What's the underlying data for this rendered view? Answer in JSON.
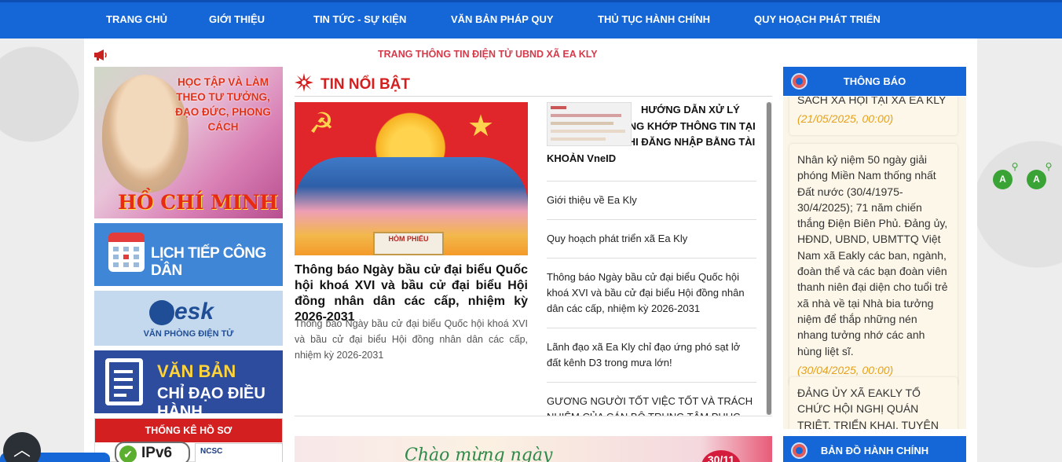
{
  "nav": {
    "items": [
      "TRANG CHỦ",
      "GIỚI THIỆU",
      "TIN TỨC - SỰ KIỆN",
      "VĂN BẢN PHÁP QUY",
      "THỦ TỤC HÀNH CHÍNH",
      "QUY HOẠCH PHÁT TRIỂN"
    ]
  },
  "marquee": {
    "text": "TRANG THÔNG TIN ĐIỆN TỬ UBND XÃ EA KLY"
  },
  "left_banners": {
    "hcm_slogan": "HỌC TẬP VÀ LÀM THEO TƯ TƯỞNG, ĐẠO ĐỨC, PHONG CÁCH",
    "hcm_name": "HỒ CHÍ MINH",
    "lich_tiep": "LỊCH TIẾP CÔNG DÂN",
    "idesk_logo": "iDesk",
    "idesk_sub": "VĂN PHÒNG ĐIỆN TỬ",
    "vanban_line1": "VĂN BẢN",
    "vanban_line2": "CHỈ ĐẠO ĐIỀU HÀNH",
    "thongke": "THỐNG KÊ HỒ SƠ",
    "ipv6": "IPv6",
    "ncsc": "NCSC"
  },
  "featured": {
    "section_title": "TIN NỔI BẬT",
    "image_caption": "HÒM PHIẾU",
    "title": "Thông báo Ngày bầu cử đại biểu Quốc hội khoá XVI và bầu cử đại biểu Hội đồng nhân dân các cấp, nhiệm kỳ 2026-2031",
    "summary": "Thông báo Ngày bầu cử đại biểu Quốc hội khoá XVI và bầu cử đại biểu Hội đồng nhân dân các cấp, nhiệm kỳ 2026-2031"
  },
  "news": {
    "first": "HƯỚNG DẪN XỬ LÝ TÀI KHOẢN KHÔNG KHỚP THÔNG TIN TẠI CSDL DÂN CƯ KHI ĐĂNG NHẬP BẰNG TÀI KHOẢN VneID",
    "items": [
      "Giới thiệu về Ea Kly",
      "Quy hoạch phát triển xã Ea Kly",
      "Thông báo Ngày bầu cử đại biểu Quốc hội khoá XVI và bầu cử đại biểu Hội đồng nhân dân các cấp, nhiệm kỳ 2026-2031",
      "Lãnh đạo xã Ea Kly chỉ đạo ứng phó sạt lở đất kênh D3 trong mưa lớn!",
      "GƯƠNG NGƯỜI TỐT VIỆC TỐT VÀ TRÁCH NHIỆM CỦA CÁN BỘ TRUNG TÂM PHỤC VỤ"
    ]
  },
  "greeting": {
    "text": "Chào mừng ngày",
    "date": "30/11"
  },
  "notices": {
    "header": "THÔNG BÁO",
    "cards": [
      {
        "text": "SÁCH XÃ HỘI TẠI XÃ EA KLY",
        "date": "(21/05/2025, 00:00)"
      },
      {
        "text": "Nhân kỷ niệm 50 ngày giải phóng Miền Nam thống nhất Đất nước (30/4/1975-30/4/2025); 71 năm chiến thắng Điện Biên Phủ. Đảng ủy, HĐND, UBND, UBMTTQ Việt Nam xã Eakly các ban, ngành, đoàn thể và các bạn đoàn viên thanh niên đại diện cho tuổi trẻ xã nhà về tại Nhà bia tưởng niệm để thắp những nén nhang tưởng nhớ các anh hùng liệt sĩ.",
        "date": "(30/04/2025, 00:00)"
      },
      {
        "text": "ĐẢNG ỦY XÃ EAKLY TỔ CHỨC HỘI NGHỊ QUÁN TRIỆT, TRIỂN KHAI, TUYÊN TRUYỀN KẾT",
        "date": ""
      }
    ]
  },
  "map": {
    "header": "BẢN ĐỒ HÀNH CHÍNH"
  },
  "font_tools": {
    "decrease": "A",
    "increase": "A"
  }
}
